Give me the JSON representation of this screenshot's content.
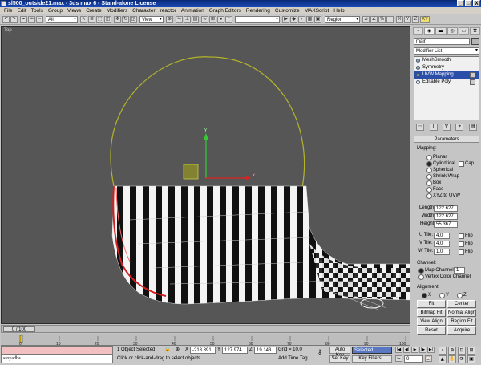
{
  "window": {
    "title": "sl500_outside21.max - 3ds max 6 - Stand-alone License",
    "min": "_",
    "max": "□",
    "close": "X"
  },
  "menu": [
    "File",
    "Edit",
    "Tools",
    "Group",
    "Views",
    "Create",
    "Modifiers",
    "Character",
    "reactor",
    "Animation",
    "Graph Editors",
    "Rendering",
    "Customize",
    "MAXScript",
    "Help"
  ],
  "toolbar": {
    "filter_value": "All",
    "refcoord_value": "View",
    "selset_value": "Region",
    "axis_x": "X",
    "axis_y": "Y",
    "axis_xy": "XY"
  },
  "viewport": {
    "label": "Top"
  },
  "command_panel": {
    "tabs": [
      "✦",
      "◉",
      "▬",
      "◎",
      "▭",
      "⚒"
    ],
    "object_name": "main",
    "modifier_list": "Modifier List",
    "stack": [
      {
        "label": "MeshSmooth",
        "selected": false
      },
      {
        "label": "Symmetry",
        "selected": false
      },
      {
        "label": "UVW Mapping",
        "selected": true
      },
      {
        "label": "Editable Poly",
        "selected": false
      }
    ],
    "stack_tools": [
      "⊣",
      "I",
      "∀",
      "⌖",
      "▤"
    ],
    "rollout_title": "Parameters",
    "mapping_group": "Mapping:",
    "mapping_options": [
      "Planar",
      "Cylindrical",
      "Spherical",
      "Shrink Wrap",
      "Box",
      "Face",
      "XYZ to UVW"
    ],
    "cap_label": "Cap",
    "length_label": "Length:",
    "length_value": "122.627",
    "width_label": "Width:",
    "width_value": "122.627",
    "height_label": "Height:",
    "height_value": "55.367",
    "utile_label": "U Tile:",
    "utile_value": "4.0",
    "vtile_label": "V Tile:",
    "vtile_value": "4.0",
    "wtile_label": "W Tile:",
    "wtile_value": "1.0",
    "flip_label": "Flip",
    "channel_group": "Channel:",
    "map_channel_label": "Map Channel:",
    "map_channel_value": "1",
    "vertex_color_label": "Vertex Color Channel",
    "alignment_group": "Alignment:",
    "align_x": "X",
    "align_y": "Y",
    "align_z": "Z",
    "btn_fit": "Fit",
    "btn_center": "Center",
    "btn_bitmap_fit": "Bitmap Fit",
    "btn_normal_align": "Normal Align",
    "btn_view_align": "View Align",
    "btn_region_fit": "Region Fit",
    "btn_reset": "Reset",
    "btn_acquire": "Acquire"
  },
  "timeline": {
    "frame_label": "0 / 100",
    "ticks": [
      "0",
      "10",
      "20",
      "30",
      "40",
      "50",
      "60",
      "70",
      "80",
      "90",
      "100"
    ]
  },
  "status": {
    "maxscript_text": "sroyadba",
    "selection_count": "1 Object Selected",
    "prompt": "Click or click-and-drag to select objects",
    "x_label": "X",
    "x_value": "-218.891",
    "y_label": "Y",
    "y_value": "127.974",
    "z_label": "Z",
    "z_value": "19.143",
    "grid": "Grid = 10.0",
    "add_time_tag": "Add Time Tag",
    "auto_key": "Auto Key",
    "set_key": "Set Key",
    "key_mode_value": "Selected",
    "key_filters": "Key Filters...",
    "frame_value": "0"
  },
  "colors": {
    "viewport_bg": "#565656",
    "selected_stack": "#2b4fa8",
    "gizmo": "#b4b42a",
    "axis_y": "#33cc33",
    "axis_x": "#dd2222"
  }
}
